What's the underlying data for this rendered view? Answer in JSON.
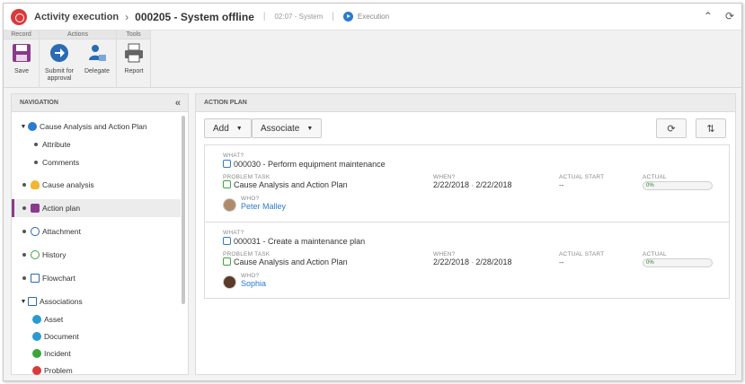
{
  "header": {
    "app_name": "Activity execution",
    "record_title": "000205 - System offline",
    "meta": "02:07 - System",
    "status": "Execution",
    "separator": "›"
  },
  "ribbon": {
    "groups": [
      {
        "label": "Record"
      },
      {
        "label": "Actions"
      },
      {
        "label": "Tools"
      }
    ],
    "buttons": {
      "save": "Save",
      "submit_line1": "Submit for",
      "submit_line2": "approval",
      "delegate": "Delegate",
      "report": "Report"
    }
  },
  "navigation": {
    "title": "NAVIGATION",
    "items": [
      {
        "label": "Cause Analysis and Action Plan"
      },
      {
        "label": "Attribute"
      },
      {
        "label": "Comments"
      },
      {
        "label": "Cause analysis"
      },
      {
        "label": "Action plan"
      },
      {
        "label": "Attachment"
      },
      {
        "label": "History"
      },
      {
        "label": "Flowchart"
      },
      {
        "label": "Associations"
      },
      {
        "label": "Asset"
      },
      {
        "label": "Document"
      },
      {
        "label": "Incident"
      },
      {
        "label": "Problem"
      }
    ]
  },
  "action_plan": {
    "title": "ACTION PLAN",
    "add_label": "Add",
    "associate_label": "Associate",
    "labels": {
      "what": "WHAT?",
      "problem_task": "PROBLEM TASK",
      "when": "WHEN?",
      "actual_start": "ACTUAL START",
      "actual": "ACTUAL",
      "who": "WHO?"
    },
    "plans": [
      {
        "what": "000030 - Perform equipment maintenance",
        "problem_task": "Cause Analysis and Action Plan",
        "when_start": "2/22/2018",
        "when_end": "2/22/2018",
        "actual_start": "--",
        "actual_progress": "0%",
        "progress_value": 0,
        "who": "Peter Malley"
      },
      {
        "what": "000031 - Create a maintenance plan",
        "problem_task": "Cause Analysis and Action Plan",
        "when_start": "2/22/2018",
        "when_end": "2/28/2018",
        "actual_start": "--",
        "actual_progress": "0%",
        "progress_value": 0,
        "who": "Sophia"
      }
    ],
    "date_separator": "-"
  },
  "colors": {
    "accent": "#2a7bd1",
    "brand": "#d93a3a",
    "active_marker": "#8b3a8b"
  }
}
